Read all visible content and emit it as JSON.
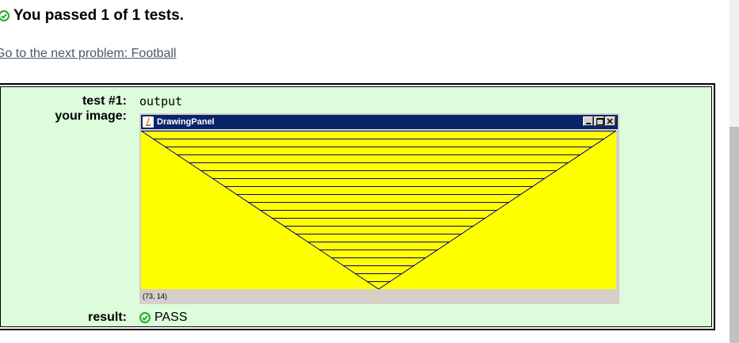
{
  "header": {
    "title": "You passed 1 of 1 tests.",
    "status_icon": "check-circle-icon",
    "status_color": "#22aa22"
  },
  "next_link": {
    "text": "Go to the next problem: Football"
  },
  "test": {
    "label": "test #1:",
    "name": "output",
    "image_label": "your image:",
    "result_label": "result:",
    "result_value": "PASS",
    "background_color": "#dcfcdc"
  },
  "drawing_panel": {
    "window_title": "DrawingPanel",
    "status_text": "(73, 14)",
    "canvas_color": "#ffff00",
    "line_color": "#000080",
    "canvas_width": 600,
    "canvas_height": 200,
    "horizontal_line_count": 20,
    "horizontal_line_spacing": 10
  }
}
